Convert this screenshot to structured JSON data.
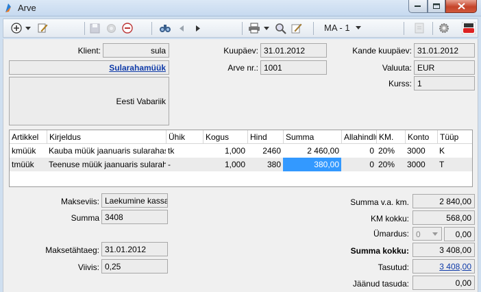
{
  "window": {
    "title": "Arve"
  },
  "toolbar": {
    "report_menu": "MA - 1"
  },
  "header": {
    "klient_label": "Klient:",
    "klient_value": "sula",
    "client_name": "Sularahamüük",
    "address": "Eesti Vabariik",
    "kuupaev_label": "Kuupäev:",
    "kuupaev_value": "31.01.2012",
    "arve_nr_label": "Arve nr.:",
    "arve_nr_value": "1001",
    "kande_label": "Kande kuupäev:",
    "kande_value": "31.01.2012",
    "valuuta_label": "Valuuta:",
    "valuuta_value": "EUR",
    "kurss_label": "Kurss:",
    "kurss_value": "1"
  },
  "grid": {
    "columns": [
      "Artikkel",
      "Kirjeldus",
      "Ühik",
      "Kogus",
      "Hind",
      "Summa",
      "Allahindlu",
      "KM.",
      "Konto",
      "Tüüp"
    ],
    "rows": [
      [
        "kmüük",
        "Kauba müük jaanuaris sularahas",
        "tk",
        "1,000",
        "2460",
        "2 460,00",
        "0",
        "20%",
        "3000",
        "K"
      ],
      [
        "tmüük",
        "Teenuse müük jaanuaris sularahas",
        "-",
        "1,000",
        "380",
        "380,00",
        "0",
        "20%",
        "3000",
        "T"
      ]
    ]
  },
  "payment": {
    "makseviis_label": "Makseviis:",
    "makseviis_value": "Laekumine kassass",
    "summa_label": "Summa",
    "summa_value": "3408",
    "tahtaeg_label": "Maksetähtaeg:",
    "tahtaeg_value": "31.01.2012",
    "viivis_label": "Viivis:",
    "viivis_value": "0,25"
  },
  "totals": {
    "summa_vaa_label": "Summa v.a. km.",
    "summa_vaa_value": "2 840,00",
    "km_label": "KM kokku:",
    "km_value": "568,00",
    "umardus_label": "Ümardus:",
    "umardus_step": "0",
    "umardus_value": "0,00",
    "kokku_label": "Summa kokku:",
    "kokku_value": "3 408,00",
    "tasutud_label": "Tasutud:",
    "tasutud_value": "3 408,00",
    "jaanud_label": "Jäänud tasuda:",
    "jaanud_value": "0,00"
  }
}
